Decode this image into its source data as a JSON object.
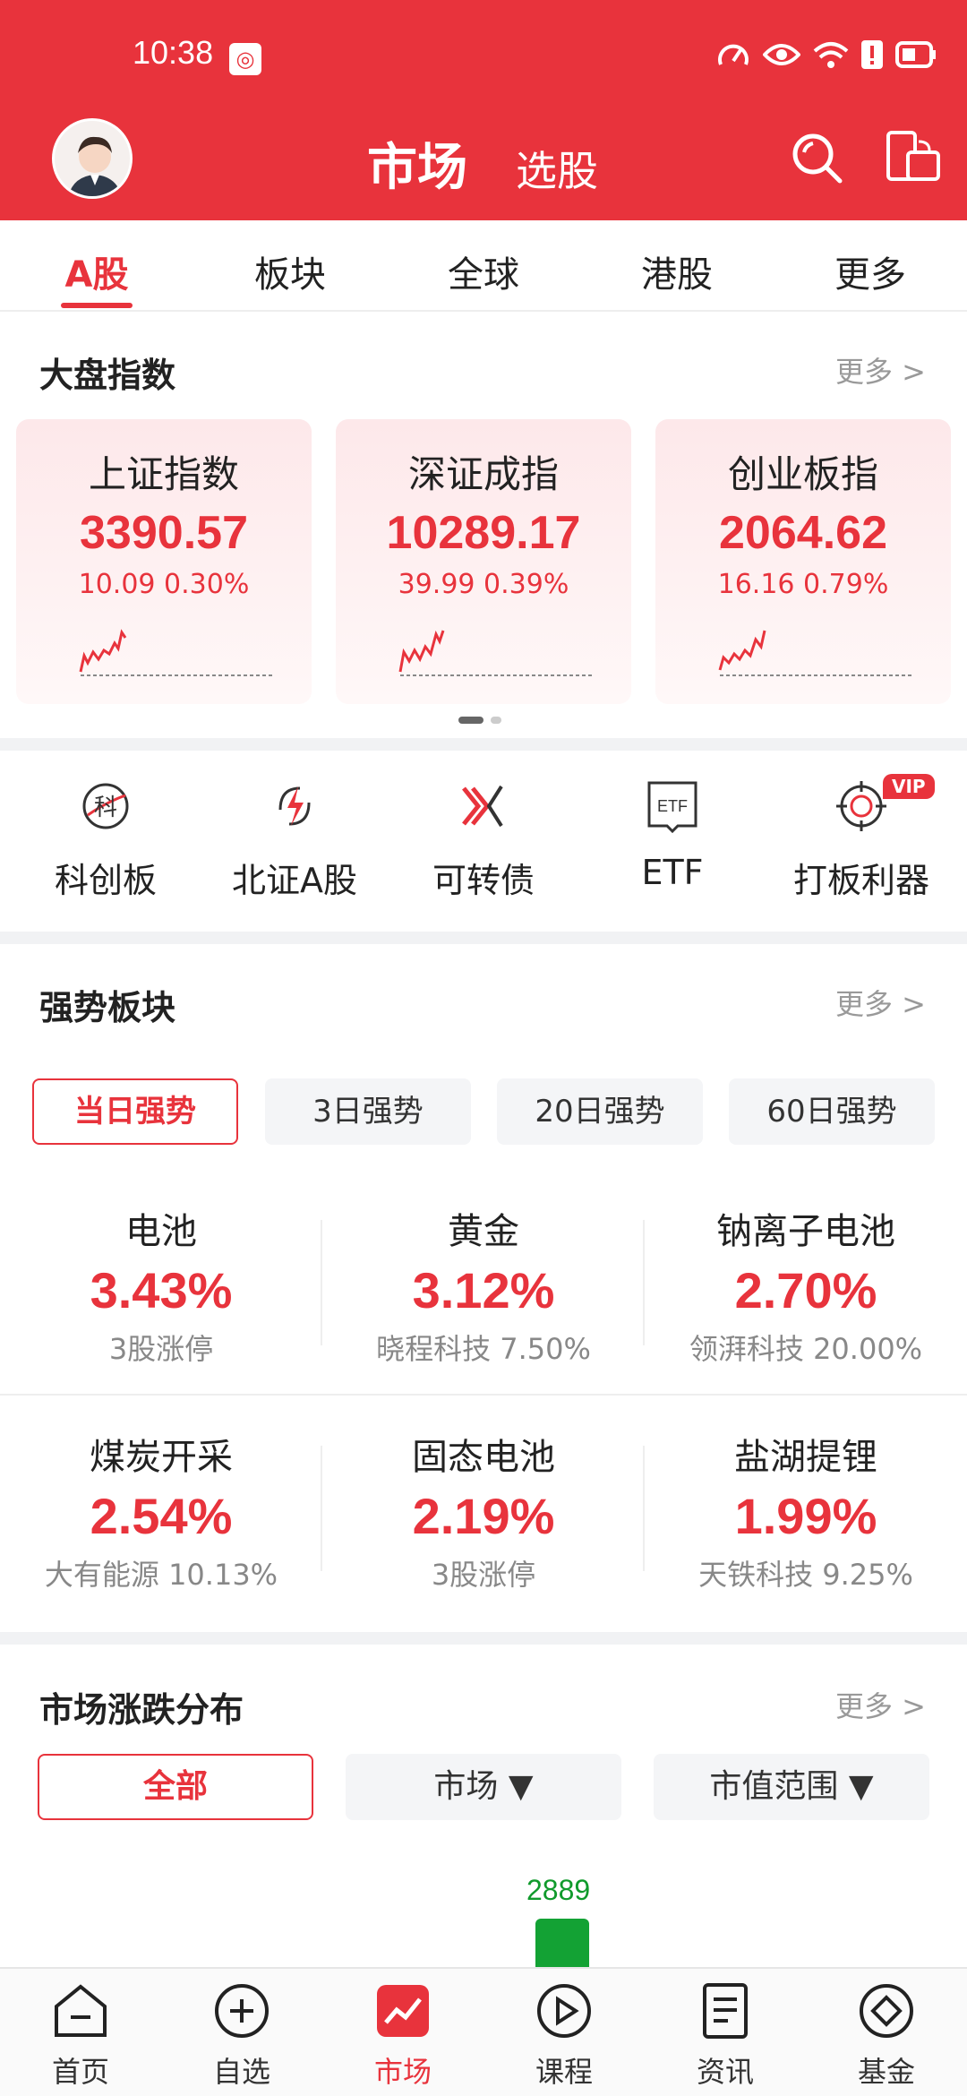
{
  "status_bar": {
    "time": "10:38"
  },
  "header": {
    "title": "市场",
    "subtitle": "选股"
  },
  "tabs": [
    {
      "label": "A股",
      "active": true
    },
    {
      "label": "板块"
    },
    {
      "label": "全球"
    },
    {
      "label": "港股"
    },
    {
      "label": "更多"
    }
  ],
  "indices": {
    "title": "大盘指数",
    "more": "更多 >",
    "cards": [
      {
        "name": "上证指数",
        "value": "3390.57",
        "change": "10.09  0.30%"
      },
      {
        "name": "深证成指",
        "value": "10289.17",
        "change": "39.99  0.39%"
      },
      {
        "name": "创业板指",
        "value": "2064.62",
        "change": "16.16  0.79%"
      }
    ]
  },
  "quick_entries": [
    {
      "label": "科创板",
      "icon": "kechuang-icon"
    },
    {
      "label": "北证A股",
      "icon": "lightning-icon"
    },
    {
      "label": "可转债",
      "icon": "convertible-bond-icon"
    },
    {
      "label": "ETF",
      "icon": "etf-icon"
    },
    {
      "label": "打板利器",
      "icon": "target-icon",
      "badge": "VIP"
    }
  ],
  "strong_sectors": {
    "title": "强势板块",
    "more": "更多 >",
    "filters": [
      "当日强势",
      "3日强势",
      "20日强势",
      "60日强势"
    ],
    "items": [
      {
        "name": "电池",
        "pct": "3.43%",
        "note": "3股涨停"
      },
      {
        "name": "黄金",
        "pct": "3.12%",
        "note": "晓程科技 7.50%"
      },
      {
        "name": "钠离子电池",
        "pct": "2.70%",
        "note": "领湃科技 20.00%"
      },
      {
        "name": "煤炭开采",
        "pct": "2.54%",
        "note": "大有能源 10.13%"
      },
      {
        "name": "固态电池",
        "pct": "2.19%",
        "note": "3股涨停"
      },
      {
        "name": "盐湖提锂",
        "pct": "1.99%",
        "note": "天铁科技 9.25%"
      }
    ]
  },
  "distribution": {
    "title": "市场涨跌分布",
    "more": "更多 >",
    "filters": [
      "全部",
      "市场 ▼",
      "市值范围 ▼"
    ],
    "visible_bar_value": "2889"
  },
  "bottom_nav": [
    {
      "label": "首页",
      "icon": "home-icon"
    },
    {
      "label": "自选",
      "icon": "plus-circle-icon"
    },
    {
      "label": "市场",
      "icon": "market-chart-icon",
      "active": true
    },
    {
      "label": "课程",
      "icon": "play-icon"
    },
    {
      "label": "资讯",
      "icon": "news-icon"
    },
    {
      "label": "基金",
      "icon": "fund-icon"
    }
  ],
  "colors": {
    "brand_red": "#e8333c",
    "down_green": "#13a234"
  }
}
